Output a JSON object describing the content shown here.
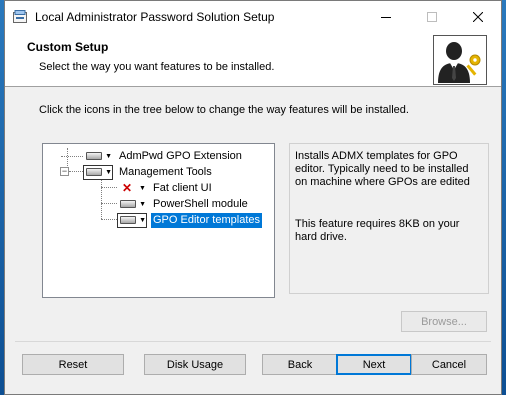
{
  "window": {
    "title": "Local Administrator Password Solution Setup",
    "controls": {
      "minimize": "—",
      "maximize": "☐",
      "close": "✕"
    }
  },
  "header": {
    "title": "Custom Setup",
    "subtitle": "Select the way you want features to be installed.",
    "logo_icon": "admin-user-key-icon"
  },
  "instruction": "Click the icons in the tree below to change the way features will be installed.",
  "tree": {
    "items": [
      {
        "label": "AdmPwd GPO Extension",
        "icon": "drive-icon",
        "state": "install"
      },
      {
        "label": "Management Tools",
        "icon": "drive-icon",
        "state": "install"
      },
      {
        "label": "Fat client UI",
        "icon": "x-icon",
        "state": "not-installed"
      },
      {
        "label": "PowerShell module",
        "icon": "drive-icon",
        "state": "install"
      },
      {
        "label": "GPO Editor templates",
        "icon": "drive-icon",
        "state": "install",
        "selected": true
      }
    ]
  },
  "description": {
    "text": "Installs ADMX templates for GPO editor. Typically need to be installed on machine where GPOs are edited",
    "requirement": "This feature requires 8KB on your hard drive."
  },
  "buttons": {
    "browse": "Browse...",
    "reset": "Reset",
    "disk_usage": "Disk Usage",
    "back": "Back",
    "next": "Next",
    "cancel": "Cancel"
  },
  "colors": {
    "selection": "#0078d7",
    "accent_key": "#e5b400"
  }
}
